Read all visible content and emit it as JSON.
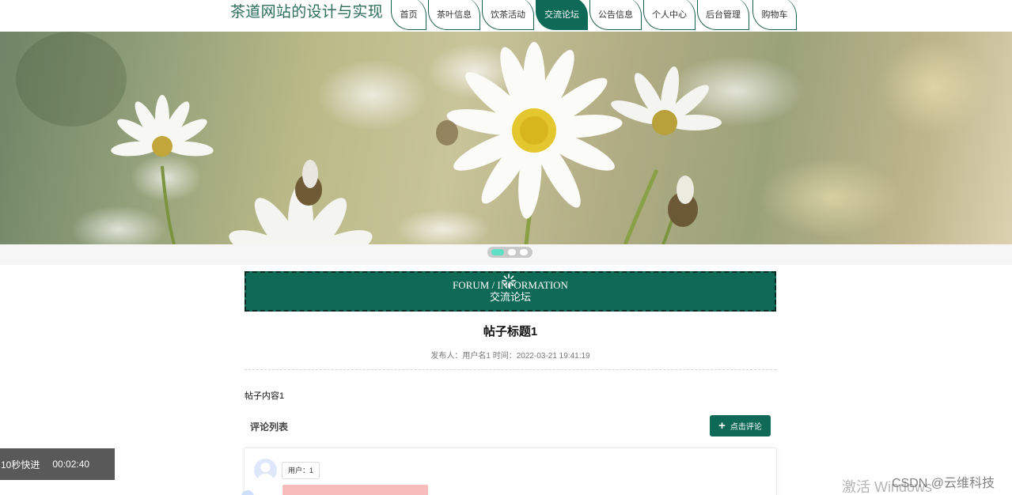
{
  "header": {
    "site_title": "茶道网站的设计与实现",
    "nav": [
      {
        "label": "首页",
        "active": false
      },
      {
        "label": "茶叶信息",
        "active": false
      },
      {
        "label": "饮茶活动",
        "active": false
      },
      {
        "label": "交流论坛",
        "active": true
      },
      {
        "label": "公告信息",
        "active": false
      },
      {
        "label": "个人中心",
        "active": false
      },
      {
        "label": "后台管理",
        "active": false
      },
      {
        "label": "购物车",
        "active": false
      }
    ]
  },
  "banner": {
    "slides_count": 3,
    "active_slide": 1
  },
  "section": {
    "title_en": "FORUM / INFORMATION",
    "title_zh": "交流论坛"
  },
  "post": {
    "title": "帖子标题1",
    "meta_author": "发布人：用户名1",
    "meta_time": "时间：2022-03-21 19:41:19",
    "content": "帖子内容1"
  },
  "comments": {
    "title": "评论列表",
    "add_button": "点击评论",
    "items": [
      {
        "user": "用户：1"
      }
    ]
  },
  "overlay": {
    "fast_forward": "10秒快进",
    "elapsed": "00:02:40",
    "windows_watermark": "激活 Windows",
    "csdn_watermark": "CSDN @云维科技"
  },
  "colors": {
    "brand": "#0f6957",
    "title": "#2d6e5b",
    "dot_active": "#5fe0c4"
  }
}
